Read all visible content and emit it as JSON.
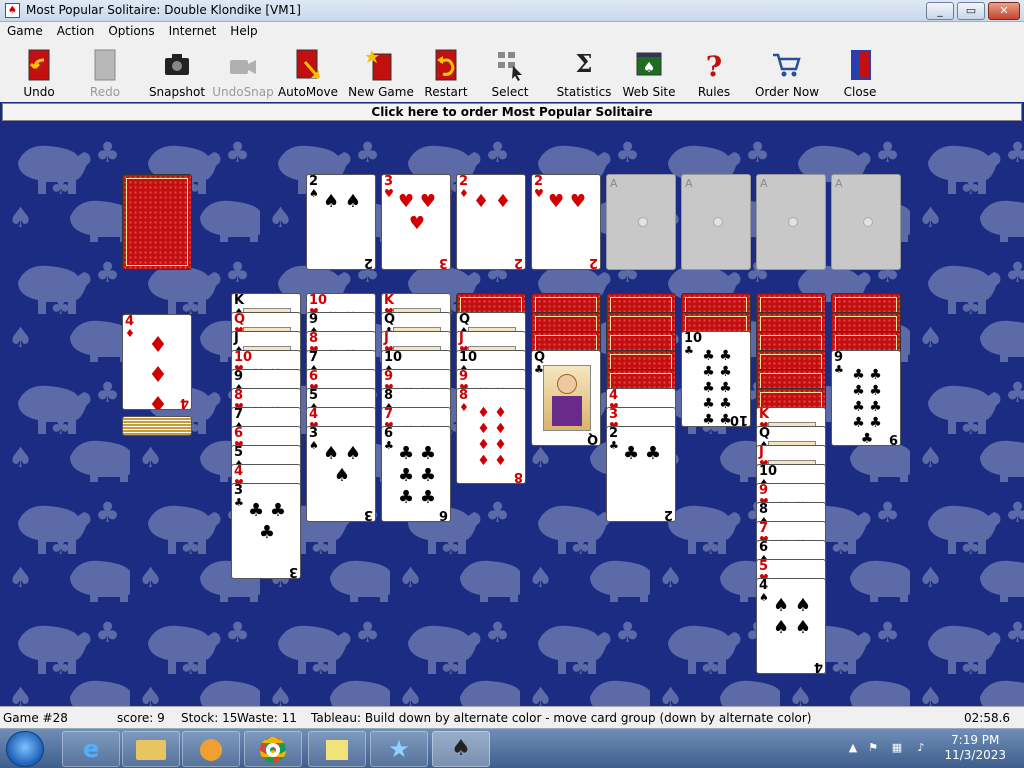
{
  "window": {
    "title": "Most Popular Solitaire: Double Klondike [VM1]",
    "min": "_",
    "max": "▭",
    "close": "✕"
  },
  "menu": [
    "Game",
    "Action",
    "Options",
    "Internet",
    "Help"
  ],
  "toolbar": [
    {
      "label": "Undo",
      "icon": "undo-icon",
      "enabled": true
    },
    {
      "label": "Redo",
      "icon": "redo-icon",
      "enabled": false
    },
    {
      "label": "Snapshot",
      "icon": "camera-icon",
      "enabled": true
    },
    {
      "label": "UndoSnap",
      "icon": "video-camera-icon",
      "enabled": false
    },
    {
      "label": "AutoMove",
      "icon": "automove-icon",
      "enabled": true
    },
    {
      "label": "New Game",
      "icon": "new-game-icon",
      "enabled": true
    },
    {
      "label": "Restart",
      "icon": "restart-icon",
      "enabled": true
    },
    {
      "label": "Select",
      "icon": "select-icon",
      "enabled": true
    },
    {
      "label": "Statistics",
      "icon": "sigma-icon",
      "enabled": true
    },
    {
      "label": "Web Site",
      "icon": "website-icon",
      "enabled": true
    },
    {
      "label": "Rules",
      "icon": "question-icon",
      "enabled": true
    },
    {
      "label": "Order Now",
      "icon": "cart-icon",
      "enabled": true
    },
    {
      "label": "Close",
      "icon": "door-icon",
      "enabled": true
    }
  ],
  "banner": "Click here to order Most Popular Solitaire",
  "stock": {
    "face_down": true
  },
  "waste": {
    "top": {
      "rank": "4",
      "suit": "♦"
    }
  },
  "foundations": [
    {
      "rank": "2",
      "suit": "♠"
    },
    {
      "rank": "3",
      "suit": "♥"
    },
    {
      "rank": "2",
      "suit": "♦"
    },
    {
      "rank": "2",
      "suit": "♥"
    },
    {
      "rank": "",
      "suit": ""
    },
    {
      "rank": "",
      "suit": ""
    },
    {
      "rank": "",
      "suit": ""
    },
    {
      "rank": "",
      "suit": ""
    }
  ],
  "empty_foundation_label": "A",
  "tableau": [
    {
      "down": 0,
      "up": [
        [
          "K",
          "♠"
        ],
        [
          "Q",
          "♥"
        ],
        [
          "J",
          "♠"
        ],
        [
          "10",
          "♥"
        ],
        [
          "9",
          "♠"
        ],
        [
          "8",
          "♥"
        ],
        [
          "7",
          "♠"
        ],
        [
          "6",
          "♥"
        ],
        [
          "5",
          "♠"
        ],
        [
          "4",
          "♥"
        ],
        [
          "3",
          "♣"
        ]
      ]
    },
    {
      "down": 0,
      "up": [
        [
          "10",
          "♥"
        ],
        [
          "9",
          "♠"
        ],
        [
          "8",
          "♥"
        ],
        [
          "7",
          "♠"
        ],
        [
          "6",
          "♥"
        ],
        [
          "5",
          "♠"
        ],
        [
          "4",
          "♥"
        ],
        [
          "3",
          "♠"
        ]
      ]
    },
    {
      "down": 0,
      "up": [
        [
          "K",
          "♥"
        ],
        [
          "Q",
          "♣"
        ],
        [
          "J",
          "♥"
        ],
        [
          "10",
          "♠"
        ],
        [
          "9",
          "♥"
        ],
        [
          "8",
          "♠"
        ],
        [
          "7",
          "♥"
        ],
        [
          "6",
          "♣"
        ]
      ]
    },
    {
      "down": 1,
      "up": [
        [
          "Q",
          "♠"
        ],
        [
          "J",
          "♥"
        ],
        [
          "10",
          "♠"
        ],
        [
          "9",
          "♥"
        ],
        [
          "8",
          "♦"
        ]
      ]
    },
    {
      "down": 3,
      "up": [
        [
          "Q",
          "♣"
        ]
      ]
    },
    {
      "down": 5,
      "up": [
        [
          "4",
          "♥"
        ],
        [
          "3",
          "♥"
        ],
        [
          "2",
          "♣"
        ]
      ]
    },
    {
      "down": 2,
      "up": [
        [
          "10",
          "♣"
        ]
      ]
    },
    {
      "down": 6,
      "up": [
        [
          "K",
          "♥"
        ],
        [
          "Q",
          "♠"
        ],
        [
          "J",
          "♥"
        ],
        [
          "10",
          "♠"
        ],
        [
          "9",
          "♥"
        ],
        [
          "8",
          "♠"
        ],
        [
          "7",
          "♥"
        ],
        [
          "6",
          "♠"
        ],
        [
          "5",
          "♥"
        ],
        [
          "4",
          "♠"
        ]
      ]
    },
    {
      "down": 3,
      "up": [
        [
          "9",
          "♣"
        ]
      ]
    }
  ],
  "status": {
    "game": "Game #28",
    "score": "score: 9",
    "stock": "Stock: 15",
    "waste": "Waste: 11",
    "hint": "Tableau: Build down by alternate color - move card group (down by alternate color)",
    "timer": "02:58.6"
  },
  "taskbar": {
    "time": "7:19 PM",
    "date": "11/3/2023"
  },
  "colors": {
    "table": "#1c2c82",
    "red_suit": "#d00000",
    "card_back": "#c21010"
  }
}
